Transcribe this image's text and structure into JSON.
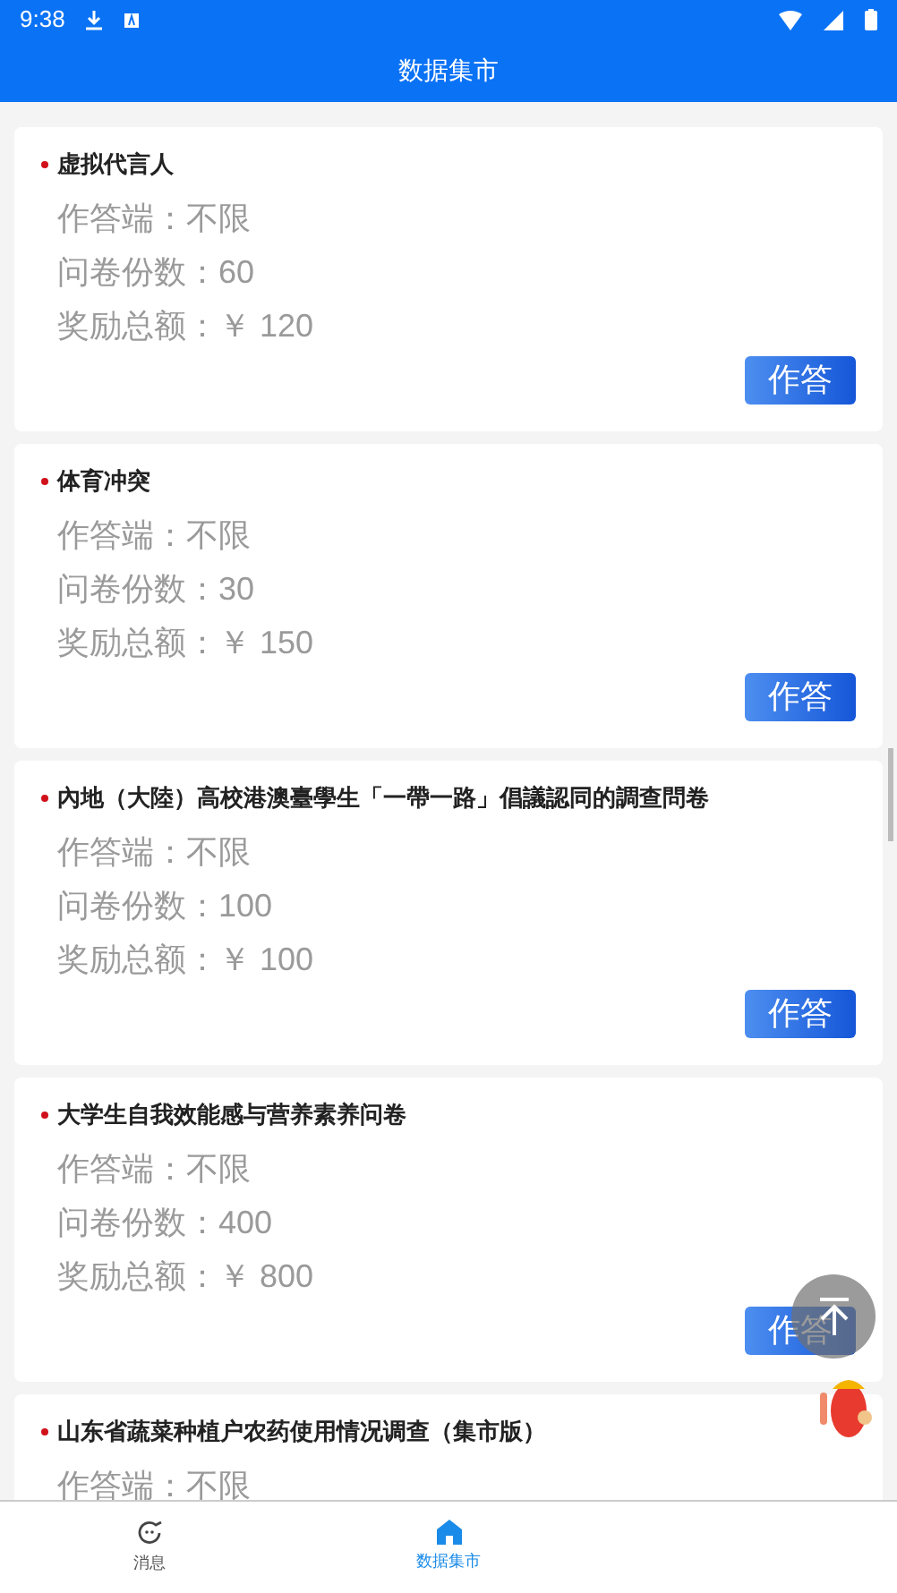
{
  "status_bar": {
    "time": "9:38"
  },
  "header": {
    "title": "数据集市"
  },
  "surveys": [
    {
      "title": "虚拟代言人",
      "platform": "作答端：不限",
      "count": "问卷份数：60",
      "reward": "奖励总额：￥ 120",
      "button": "作答"
    },
    {
      "title": "体育冲突",
      "platform": "作答端：不限",
      "count": "问卷份数：30",
      "reward": "奖励总额：￥ 150",
      "button": "作答"
    },
    {
      "title": "內地（大陸）高校港澳臺學生「一帶一路」倡議認同的調查問卷",
      "platform": "作答端：不限",
      "count": "问卷份数：100",
      "reward": "奖励总额：￥ 100",
      "button": "作答"
    },
    {
      "title": "大学生自我效能感与营养素养问卷",
      "platform": "作答端：不限",
      "count": "问卷份数：400",
      "reward": "奖励总额：￥ 800",
      "button": "作答"
    },
    {
      "title": "山东省蔬菜种植户农药使用情况调查（集市版）",
      "platform": "作答端：不限"
    }
  ],
  "bottom_nav": [
    {
      "label": "消息",
      "selected": false
    },
    {
      "label": "数据集市",
      "selected": true
    }
  ]
}
